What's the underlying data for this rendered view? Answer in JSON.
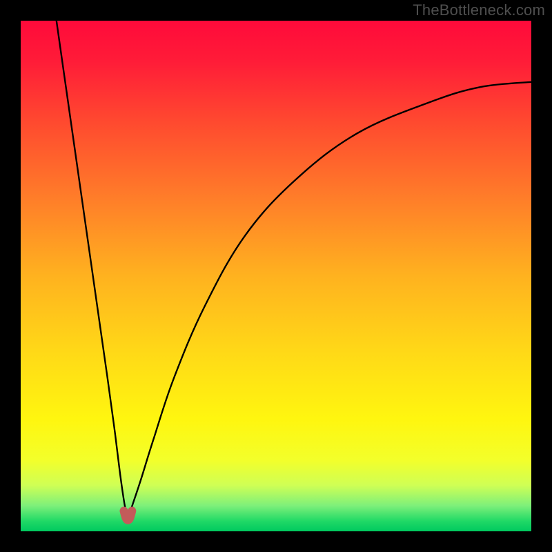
{
  "watermark": "TheBottleneck.com",
  "chart_data": {
    "type": "line",
    "title": "",
    "xlabel": "",
    "ylabel": "",
    "xlim": [
      0,
      100
    ],
    "ylim": [
      0,
      100
    ],
    "grid": false,
    "legend": false,
    "notch_x": 21,
    "series": [
      {
        "name": "left-branch",
        "x": [
          7,
          9,
          11,
          13,
          15,
          17,
          18.5,
          19.5,
          20.3,
          20.8
        ],
        "y": [
          100,
          86,
          72,
          58,
          44,
          30,
          19,
          11,
          5.5,
          3
        ]
      },
      {
        "name": "right-branch",
        "x": [
          21.2,
          22,
          23.5,
          26,
          30,
          36,
          44,
          54,
          66,
          80,
          90,
          100
        ],
        "y": [
          3,
          5.5,
          10,
          18,
          30,
          44,
          58,
          69,
          78,
          84,
          87,
          88
        ]
      },
      {
        "name": "notch",
        "x": [
          20.2,
          20.6,
          21.0,
          21.4,
          21.8
        ],
        "y": [
          4.0,
          2.6,
          2.2,
          2.6,
          4.0
        ]
      }
    ],
    "gradient_stops": [
      {
        "offset": 0.0,
        "color": "#ff0a3a"
      },
      {
        "offset": 0.08,
        "color": "#ff1c38"
      },
      {
        "offset": 0.2,
        "color": "#ff4a2f"
      },
      {
        "offset": 0.35,
        "color": "#ff7e29"
      },
      {
        "offset": 0.5,
        "color": "#ffb21f"
      },
      {
        "offset": 0.65,
        "color": "#ffd917"
      },
      {
        "offset": 0.78,
        "color": "#fff60f"
      },
      {
        "offset": 0.86,
        "color": "#f3ff2a"
      },
      {
        "offset": 0.91,
        "color": "#cfff55"
      },
      {
        "offset": 0.95,
        "color": "#7df07a"
      },
      {
        "offset": 0.98,
        "color": "#20d966"
      },
      {
        "offset": 1.0,
        "color": "#00c95f"
      }
    ],
    "notch_color": "#c35b5a"
  }
}
